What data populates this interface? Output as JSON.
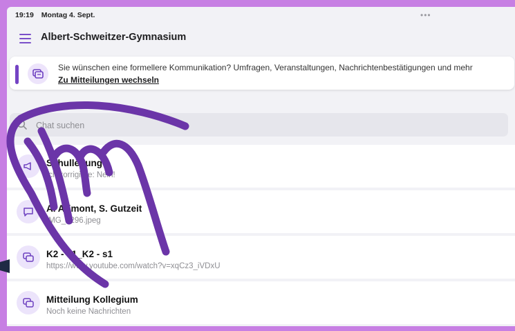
{
  "statusbar": {
    "time": "19:19",
    "date": "Montag 4. Sept.",
    "dots": "•••"
  },
  "header": {
    "title": "Albert-Schweitzer-Gymnasium"
  },
  "banner": {
    "text": "Sie wünschen eine formellere Kommunikation? Umfragen, Veranstaltungen, Nachrichtenbestätigungen und mehr",
    "link": "Zu Mitteilungen wechseln"
  },
  "search": {
    "placeholder": "Chat suchen"
  },
  "chats": [
    {
      "name": "Schulleitung",
      "preview": "Ich korrigiere: Nein!",
      "icon": "megaphone-icon"
    },
    {
      "name": "A. Arimont, S. Gutzeit",
      "preview": "IMG_3296.jpeg",
      "icon": "chat-bubble-icon"
    },
    {
      "name": "K2 - s1_K2 - s1",
      "preview": "https://www.youtube.com/watch?v=xqCz3_iVDxU",
      "icon": "group-chat-icon"
    },
    {
      "name": "Mitteilung Kollegium",
      "preview": "Noch keine Nachrichten",
      "icon": "group-chat-icon"
    }
  ],
  "colors": {
    "frame": "#c77fe3",
    "accent": "#7443c4",
    "overlay_hand": "#6b35a8"
  }
}
